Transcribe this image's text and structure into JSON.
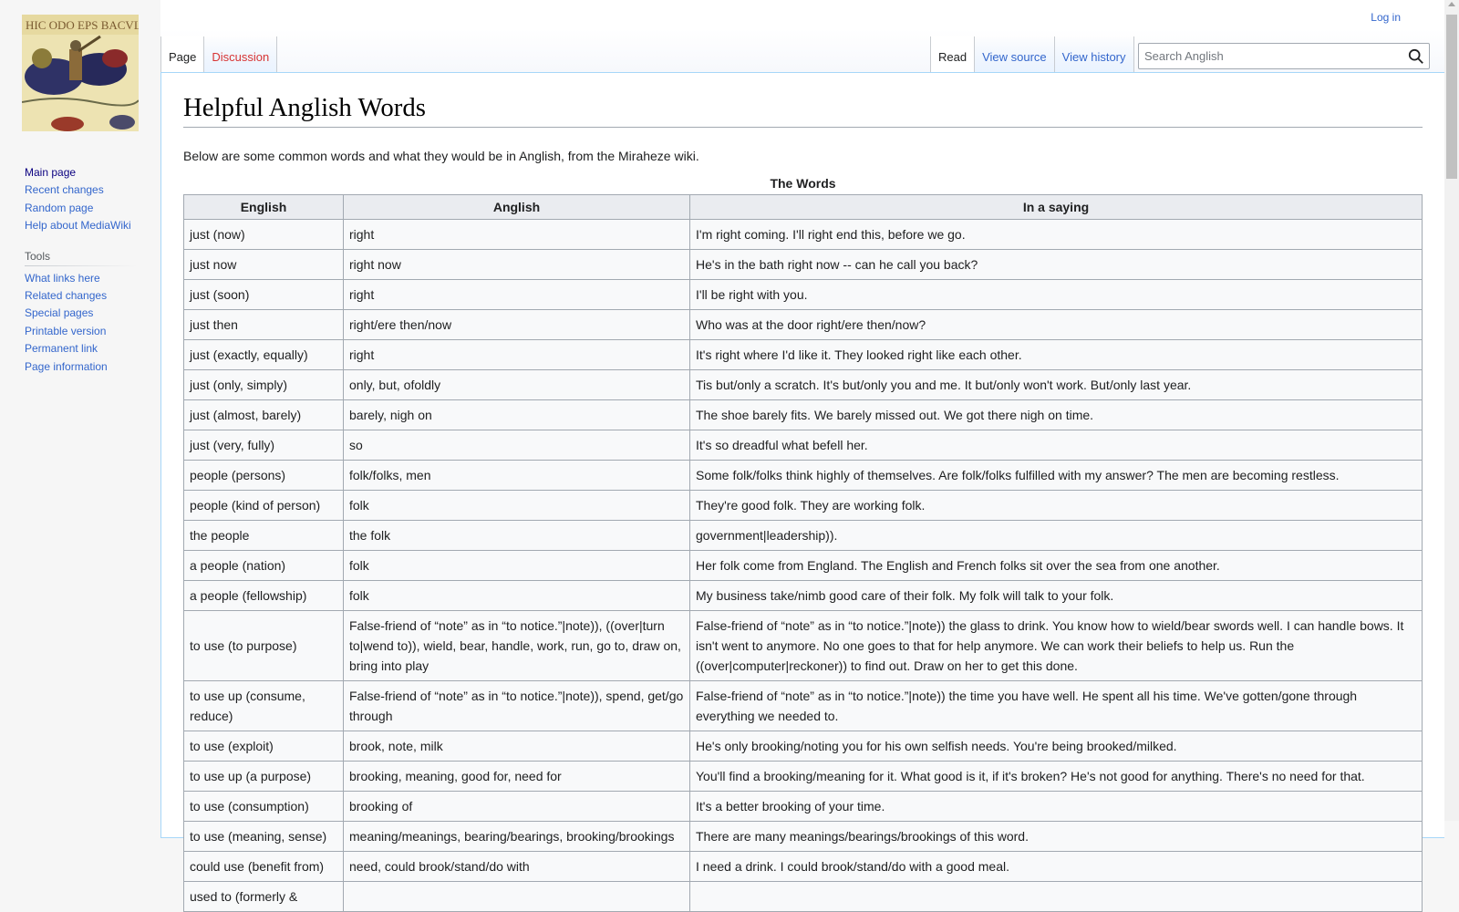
{
  "site": {
    "name": "Anglish",
    "logo_alt": "Bayeux tapestry logo"
  },
  "personal": {
    "login": "Log in"
  },
  "tabs": {
    "namespaces": [
      {
        "label": "Page",
        "selected": true
      },
      {
        "label": "Discussion",
        "new": true
      }
    ],
    "views": [
      {
        "label": "Read",
        "selected": true
      },
      {
        "label": "View source"
      },
      {
        "label": "View history"
      }
    ]
  },
  "search": {
    "placeholder": "Search Anglish",
    "value": "",
    "icon": "search-icon"
  },
  "sidebar": {
    "navigation": [
      {
        "label": "Main page"
      },
      {
        "label": "Recent changes"
      },
      {
        "label": "Random page"
      },
      {
        "label": "Help about MediaWiki"
      }
    ],
    "tools": {
      "heading": "Tools",
      "items": [
        {
          "label": "What links here"
        },
        {
          "label": "Related changes"
        },
        {
          "label": "Special pages"
        },
        {
          "label": "Printable version"
        },
        {
          "label": "Permanent link"
        },
        {
          "label": "Page information"
        }
      ]
    }
  },
  "page": {
    "title": "Helpful Anglish Words",
    "intro": "Below are some common words and what they would be in Anglish, from the Miraheze wiki.",
    "table": {
      "caption": "The Words",
      "headers": [
        "English",
        "Anglish",
        "In a saying"
      ],
      "rows": [
        [
          "just (now)",
          "right",
          "I'm right coming. I'll right end this, before we go."
        ],
        [
          "just now",
          "right now",
          "He's in the bath right now -- can he call you back?"
        ],
        [
          "just (soon)",
          "right",
          "I'll be right with you."
        ],
        [
          "just then",
          "right/ere then/now",
          "Who was at the door right/ere then/now?"
        ],
        [
          "just (exactly, equally)",
          "right",
          "It's right where I'd like it. They looked right like each other."
        ],
        [
          "just (only, simply)",
          "only, but, ofoldly",
          "Tis but/only a scratch. It's but/only you and me. It but/only won't work. But/only last year."
        ],
        [
          "just (almost, barely)",
          "barely, nigh on",
          "The shoe barely fits. We barely missed out. We got there nigh on time."
        ],
        [
          "just (very, fully)",
          "so",
          "It's so dreadful what befell her."
        ],
        [
          "people (persons)",
          "folk/folks, men",
          "Some folk/folks think highly of themselves. Are folk/folks fulfilled with my answer? The men are becoming restless."
        ],
        [
          "people (kind of person)",
          "folk",
          "They're good folk. They are working folk."
        ],
        [
          "the people",
          "the folk",
          "government|leadership))."
        ],
        [
          "a people (nation)",
          "folk",
          "Her folk come from England. The English and French folks sit over the sea from one another."
        ],
        [
          "a people (fellowship)",
          "folk",
          "My business take/nimb good care of their folk. My folk will talk to your folk."
        ],
        [
          "to use (to purpose)",
          "False-friend of “note” as in “to notice.”|note)), ((over|turn to|wend to)), wield, bear, handle, work, run, go to, draw on, bring into play",
          "False-friend of “note” as in “to notice.”|note)) the glass to drink. You know how to wield/bear swords well. I can handle bows. It isn't went to anymore. No one goes to that for help anymore. We can work their beliefs to help us. Run the ((over|computer|reckoner)) to find out. Draw on her to get this done."
        ],
        [
          "to use up (consume, reduce)",
          "False-friend of “note” as in “to notice.”|note)), spend, get/go through",
          "False-friend of “note” as in “to notice.”|note)) the time you have well. He spent all his time. We've gotten/gone through everything we needed to."
        ],
        [
          "to use (exploit)",
          "brook, note, milk",
          "He's only brooking/noting you for his own selfish needs. You're being brooked/milked."
        ],
        [
          "to use up (a purpose)",
          "brooking, meaning, good for, need for",
          "You'll find a brooking/meaning for it. What good is it, if it's broken? He's not good for anything. There's no need for that."
        ],
        [
          "to use (consumption)",
          "brooking of",
          "It's a better brooking of your time."
        ],
        [
          "to use (meaning, sense)",
          "meaning/meanings, bearing/bearings, brooking/brookings",
          "There are many meanings/bearings/brookings of this word."
        ],
        [
          "could use (benefit from)",
          "need, could brook/stand/do with",
          "I need a drink. I could brook/stand/do with a good meal."
        ],
        [
          "used to (formerly & ",
          "",
          ""
        ]
      ]
    }
  },
  "colors": {
    "link": "#3366cc",
    "visited_link": "#0b0080",
    "new_link": "#d73333",
    "table_header_bg": "#eaecf0",
    "table_bg": "#f8f9fa",
    "border": "#a2a9b1"
  }
}
